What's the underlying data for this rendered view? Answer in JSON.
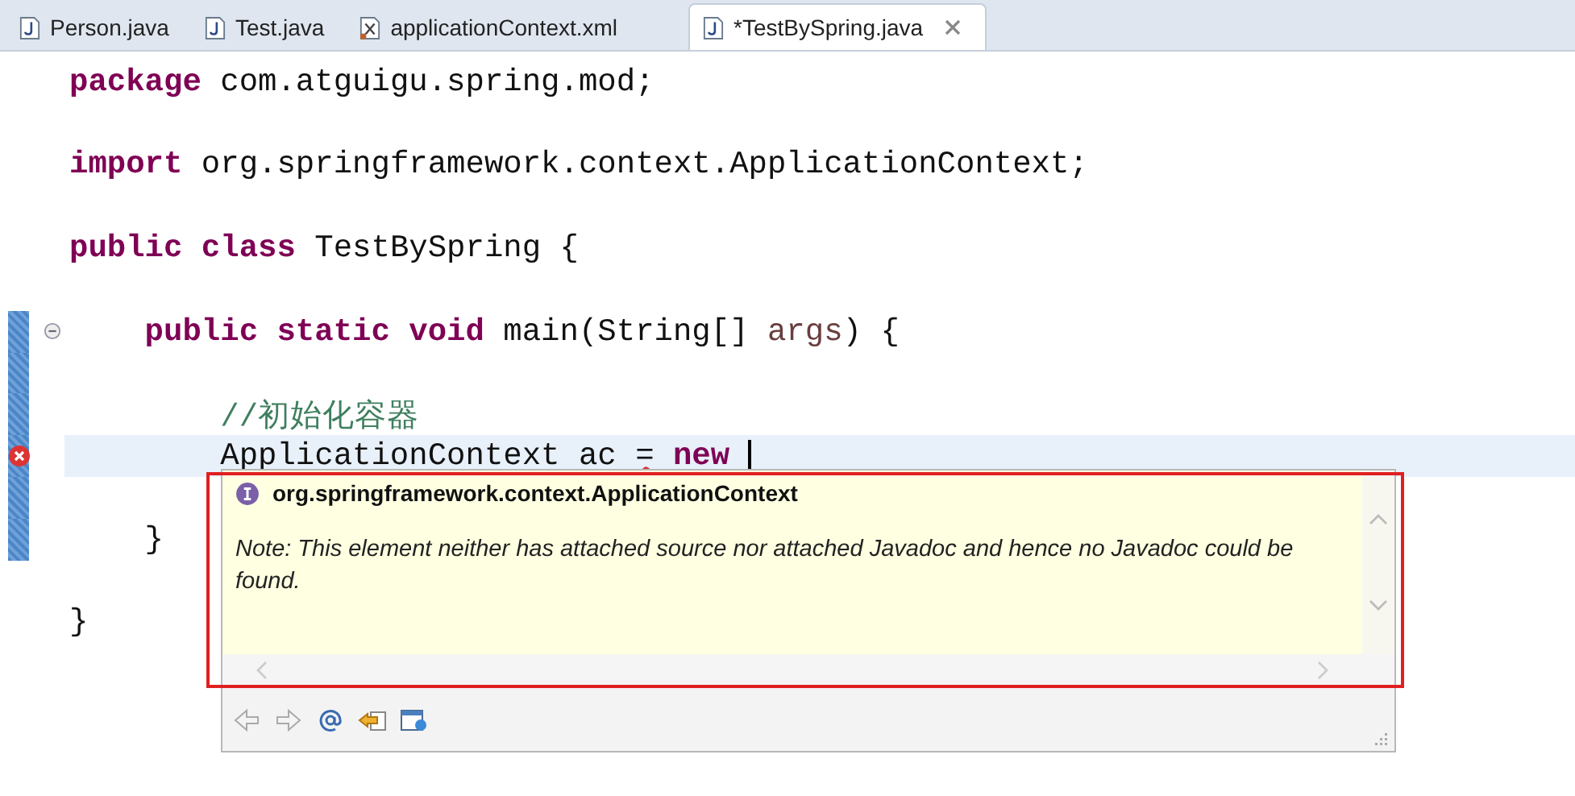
{
  "tabs": [
    {
      "label": "Person.java",
      "kind": "java",
      "selected": false
    },
    {
      "label": "Test.java",
      "kind": "java",
      "selected": false
    },
    {
      "label": "applicationContext.xml",
      "kind": "xml",
      "selected": false
    },
    {
      "label": "*TestBySpring.java",
      "kind": "java",
      "selected": true
    }
  ],
  "code_lines": [
    {
      "blank_line_after": true,
      "tokens": [
        {
          "kind": "keyword",
          "text": "package"
        },
        {
          "kind": "plain",
          "text": " com.atguigu.spring.mod;"
        }
      ]
    },
    {
      "blank_line_after": true,
      "tokens": [
        {
          "kind": "keyword",
          "text": "import"
        },
        {
          "kind": "plain",
          "text": " org.springframework.context.ApplicationContext;"
        }
      ]
    },
    {
      "blank_line_after": true,
      "tokens": [
        {
          "kind": "keyword",
          "text": "public class"
        },
        {
          "kind": "plain",
          "text": " TestBySpring {"
        }
      ]
    },
    {
      "changed": true,
      "foldable": true,
      "tokens": [
        {
          "kind": "keyword",
          "text": "    public static void"
        },
        {
          "kind": "plain",
          "text": " main(String[] "
        },
        {
          "kind": "param",
          "text": "args"
        },
        {
          "kind": "plain",
          "text": ") {"
        }
      ]
    },
    {
      "changed": true
    },
    {
      "changed": true,
      "tokens": [
        {
          "kind": "comment",
          "text": "        //初始化容器"
        }
      ]
    },
    {
      "changed": true,
      "current": true,
      "error": true,
      "caret": true,
      "tokens": [
        {
          "kind": "plain",
          "text": "        ApplicationContext ac "
        },
        {
          "kind": "error",
          "text": "="
        },
        {
          "kind": "keyword",
          "text": " new "
        }
      ]
    },
    {
      "changed": true
    },
    {
      "changed": true,
      "blank_line_after": true,
      "tokens": [
        {
          "kind": "plain",
          "text": "    }"
        }
      ]
    },
    {
      "tokens": [
        {
          "kind": "plain",
          "text": "}"
        }
      ]
    }
  ],
  "hover_popup": {
    "title": "org.springframework.context.ApplicationContext",
    "note": "Note: This element neither has attached source nor attached Javadoc and hence no Javadoc could be found."
  }
}
